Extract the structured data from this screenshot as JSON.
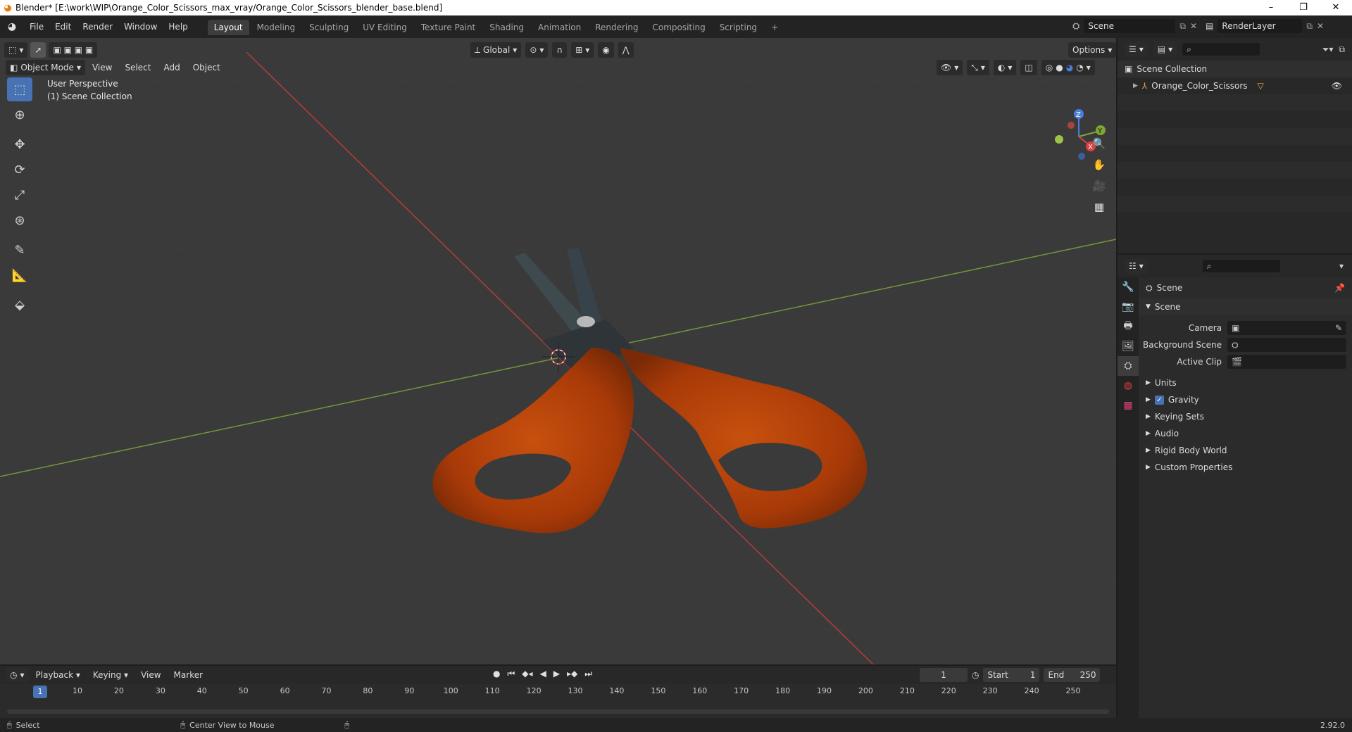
{
  "window": {
    "title": "Blender* [E:\\work\\WIP\\Orange_Color_Scissors_max_vray/Orange_Color_Scissors_blender_base.blend]",
    "minimize": "–",
    "restore": "❐",
    "close": "✕"
  },
  "menu": [
    "File",
    "Edit",
    "Render",
    "Window",
    "Help"
  ],
  "workspaces": [
    "Layout",
    "Modeling",
    "Sculpting",
    "UV Editing",
    "Texture Paint",
    "Shading",
    "Animation",
    "Rendering",
    "Compositing",
    "Scripting"
  ],
  "add_workspace": "+",
  "scene_selector": {
    "scene": "Scene",
    "view_layer": "RenderLayer"
  },
  "viewport": {
    "mode": "Object Mode",
    "menus": [
      "View",
      "Select",
      "Add",
      "Object"
    ],
    "transform_orientation": "Global",
    "options_label": "Options",
    "overlay_text": [
      "User Perspective",
      "(1) Scene Collection"
    ],
    "gizmo_axes": {
      "z": "Z",
      "y": "Y",
      "x": "X"
    }
  },
  "outliner": {
    "root": "Scene Collection",
    "items": [
      {
        "name": "Orange_Color_Scissors"
      }
    ]
  },
  "properties": {
    "header": "Scene",
    "panel": "Scene",
    "fields": [
      {
        "label": "Camera",
        "value": ""
      },
      {
        "label": "Background Scene",
        "value": ""
      },
      {
        "label": "Active Clip",
        "value": ""
      }
    ],
    "subpanels": [
      {
        "label": "Units",
        "checkbox": false
      },
      {
        "label": "Gravity",
        "checkbox": true
      },
      {
        "label": "Keying Sets",
        "checkbox": false
      },
      {
        "label": "Audio",
        "checkbox": false
      },
      {
        "label": "Rigid Body World",
        "checkbox": false
      },
      {
        "label": "Custom Properties",
        "checkbox": false
      }
    ]
  },
  "timeline": {
    "menus": [
      "Playback",
      "Keying",
      "View",
      "Marker"
    ],
    "current_frame": "1",
    "start_label": "Start",
    "start": "1",
    "end_label": "End",
    "end": "250",
    "ruler": [
      "10",
      "20",
      "30",
      "40",
      "50",
      "60",
      "70",
      "80",
      "90",
      "100",
      "110",
      "120",
      "130",
      "140",
      "150",
      "160",
      "170",
      "180",
      "190",
      "200",
      "210",
      "220",
      "230",
      "240",
      "250"
    ],
    "playhead": "1"
  },
  "status": {
    "left": "Select",
    "middle": "Center View to Mouse",
    "version": "2.92.0"
  },
  "colors": {
    "accent": "#4772b3",
    "x_axis": "#d94040",
    "y_axis": "#7fa534",
    "handle_orange": "#b8420a"
  }
}
